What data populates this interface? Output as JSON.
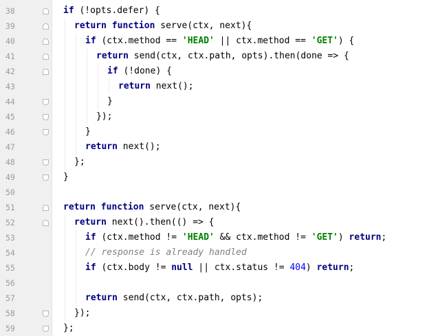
{
  "lines": [
    {
      "num": "38",
      "indent": 0,
      "fold": "open",
      "tokens": [
        {
          "t": "if",
          "c": "kw"
        },
        {
          "t": " (!opts.defer) {",
          "c": ""
        }
      ]
    },
    {
      "num": "39",
      "indent": 1,
      "fold": "open",
      "tokens": [
        {
          "t": "return",
          "c": "kw"
        },
        {
          "t": " ",
          "c": ""
        },
        {
          "t": "function",
          "c": "kw"
        },
        {
          "t": " serve(ctx, next){",
          "c": ""
        }
      ]
    },
    {
      "num": "40",
      "indent": 2,
      "fold": "open",
      "tokens": [
        {
          "t": "if",
          "c": "kw"
        },
        {
          "t": " (ctx.method == ",
          "c": ""
        },
        {
          "t": "'HEAD'",
          "c": "str"
        },
        {
          "t": " || ctx.method == ",
          "c": ""
        },
        {
          "t": "'GET'",
          "c": "str"
        },
        {
          "t": ") {",
          "c": ""
        }
      ]
    },
    {
      "num": "41",
      "indent": 3,
      "fold": "open",
      "tokens": [
        {
          "t": "return",
          "c": "kw"
        },
        {
          "t": " send(ctx, ctx.path, opts).then(done => {",
          "c": ""
        }
      ]
    },
    {
      "num": "42",
      "indent": 4,
      "fold": "open",
      "tokens": [
        {
          "t": "if",
          "c": "kw"
        },
        {
          "t": " (!done) {",
          "c": ""
        }
      ]
    },
    {
      "num": "43",
      "indent": 5,
      "fold": "",
      "tokens": [
        {
          "t": "return",
          "c": "kw"
        },
        {
          "t": " next();",
          "c": ""
        }
      ]
    },
    {
      "num": "44",
      "indent": 4,
      "fold": "close",
      "tokens": [
        {
          "t": "}",
          "c": ""
        }
      ]
    },
    {
      "num": "45",
      "indent": 3,
      "fold": "close",
      "tokens": [
        {
          "t": "});",
          "c": ""
        }
      ]
    },
    {
      "num": "46",
      "indent": 2,
      "fold": "close",
      "tokens": [
        {
          "t": "}",
          "c": ""
        }
      ]
    },
    {
      "num": "47",
      "indent": 2,
      "fold": "",
      "tokens": [
        {
          "t": "return",
          "c": "kw"
        },
        {
          "t": " next();",
          "c": ""
        }
      ]
    },
    {
      "num": "48",
      "indent": 1,
      "fold": "close",
      "tokens": [
        {
          "t": "};",
          "c": ""
        }
      ]
    },
    {
      "num": "49",
      "indent": 0,
      "fold": "close",
      "tokens": [
        {
          "t": "}",
          "c": ""
        }
      ]
    },
    {
      "num": "50",
      "indent": 0,
      "fold": "",
      "tokens": []
    },
    {
      "num": "51",
      "indent": 0,
      "fold": "open",
      "tokens": [
        {
          "t": "return",
          "c": "kw"
        },
        {
          "t": " ",
          "c": ""
        },
        {
          "t": "function",
          "c": "kw"
        },
        {
          "t": " serve(ctx, next){",
          "c": ""
        }
      ]
    },
    {
      "num": "52",
      "indent": 1,
      "fold": "open",
      "tokens": [
        {
          "t": "return",
          "c": "kw"
        },
        {
          "t": " next().then(() => {",
          "c": ""
        }
      ]
    },
    {
      "num": "53",
      "indent": 2,
      "fold": "",
      "tokens": [
        {
          "t": "if",
          "c": "kw"
        },
        {
          "t": " (ctx.method != ",
          "c": ""
        },
        {
          "t": "'HEAD'",
          "c": "str"
        },
        {
          "t": " && ctx.method != ",
          "c": ""
        },
        {
          "t": "'GET'",
          "c": "str"
        },
        {
          "t": ") ",
          "c": ""
        },
        {
          "t": "return",
          "c": "kw"
        },
        {
          "t": ";",
          "c": ""
        }
      ]
    },
    {
      "num": "54",
      "indent": 2,
      "fold": "",
      "tokens": [
        {
          "t": "// response is already handled",
          "c": "cm"
        }
      ]
    },
    {
      "num": "55",
      "indent": 2,
      "fold": "",
      "tokens": [
        {
          "t": "if",
          "c": "kw"
        },
        {
          "t": " (ctx.body != ",
          "c": ""
        },
        {
          "t": "null",
          "c": "kw"
        },
        {
          "t": " || ctx.status != ",
          "c": ""
        },
        {
          "t": "404",
          "c": "num"
        },
        {
          "t": ") ",
          "c": ""
        },
        {
          "t": "return",
          "c": "kw"
        },
        {
          "t": ";",
          "c": ""
        }
      ]
    },
    {
      "num": "56",
      "indent": 2,
      "fold": "",
      "tokens": []
    },
    {
      "num": "57",
      "indent": 2,
      "fold": "",
      "tokens": [
        {
          "t": "return",
          "c": "kw"
        },
        {
          "t": " send(ctx, ctx.path, opts);",
          "c": ""
        }
      ]
    },
    {
      "num": "58",
      "indent": 1,
      "fold": "close",
      "tokens": [
        {
          "t": "});",
          "c": ""
        }
      ]
    },
    {
      "num": "59",
      "indent": 0,
      "fold": "close",
      "tokens": [
        {
          "t": "};",
          "c": ""
        }
      ]
    }
  ],
  "colors": {
    "keyword": "#000080",
    "string": "#008000",
    "number": "#0000ff",
    "comment": "#808080",
    "gutter": "#f0f0f0"
  }
}
